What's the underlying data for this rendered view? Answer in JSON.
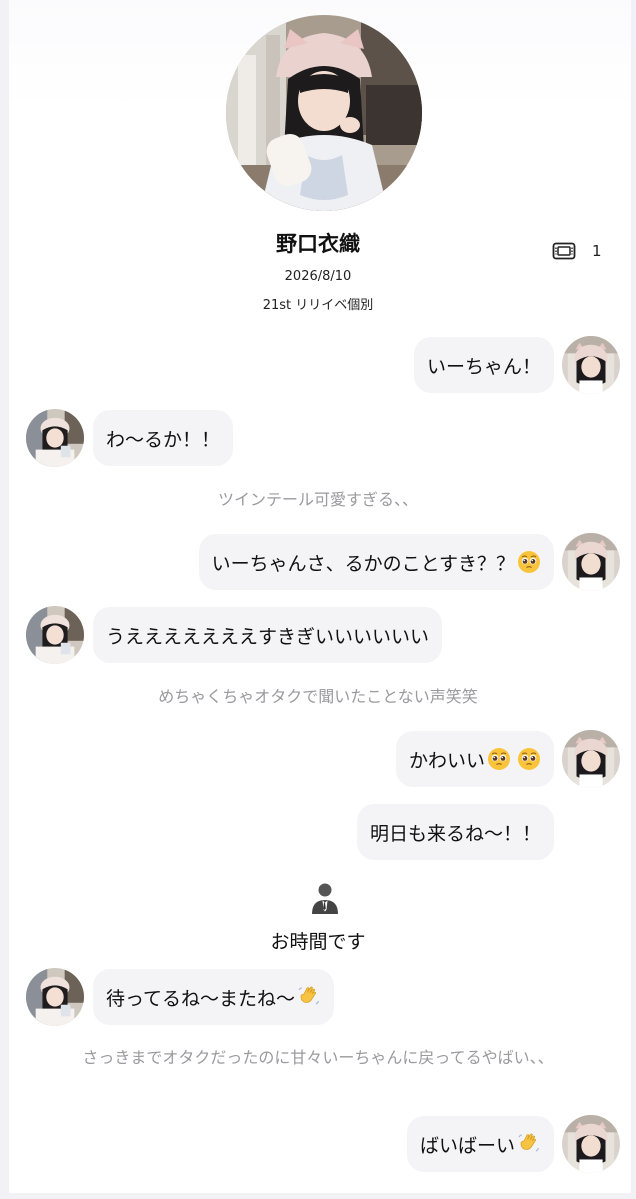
{
  "profile": {
    "name": "野口衣織",
    "date": "2026/8/10",
    "event": "21st リリイベ個別",
    "ticket_count": "1"
  },
  "messages": {
    "m1": "いーちゃん！",
    "m2": "わ〜るか！！",
    "n1": "ツインテール可愛すぎる、、",
    "m3": "いーちゃんさ、るかのことすき？？",
    "m4": "うえええええええすきぎいいいいいい",
    "n2": "めちゃくちゃオタクで聞いたことない声笑笑",
    "m5": "かわいい",
    "m6": "明日も来るね〜！！",
    "staff": "お時間です",
    "m7": "待ってるね〜またね〜",
    "n3": "さっきまでオタクだったのに甘々いーちゃんに戻ってるやばい、、",
    "m8": "ばいばーい"
  },
  "icons": {
    "ticket": "ticket-icon",
    "staff": "staff-person-icon",
    "pleading": "pleading-face-emoji",
    "wave": "waving-hand-emoji"
  },
  "colors": {
    "bubble": "#f4f4f6",
    "note_text": "#9a9a9f",
    "background": "#ffffff"
  }
}
